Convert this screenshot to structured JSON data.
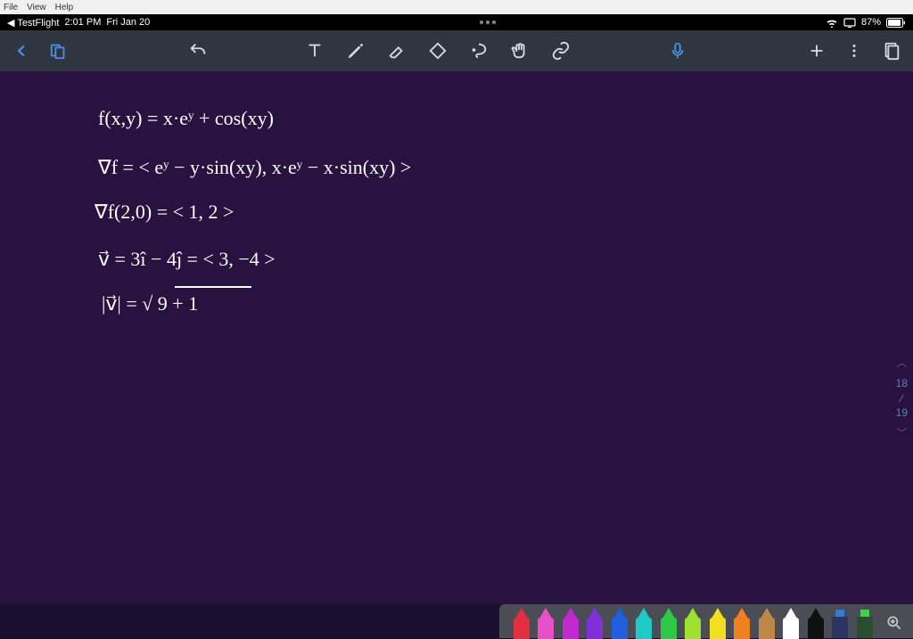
{
  "menu": {
    "file": "File",
    "view": "View",
    "help": "Help"
  },
  "status": {
    "back_app": "◀ TestFlight",
    "time": "2:01 PM",
    "date": "Fri Jan 20",
    "battery_pct": "87%"
  },
  "toolbar": {
    "back": "back",
    "browser": "browser",
    "undo": "undo",
    "text_tool": "text",
    "pen_tool": "pen",
    "eraser_tool": "eraser",
    "shape_eraser": "shape-eraser",
    "lasso": "lasso",
    "hand": "hand",
    "link": "link",
    "mic": "mic",
    "add": "add",
    "more": "more",
    "pages": "pages"
  },
  "notes": {
    "line1": "f(x,y) = x·eʸ + cos(xy)",
    "line2": "∇f = < eʸ − y·sin(xy),  x·eʸ − x·sin(xy) >",
    "line3": "∇f(2,0) = < 1, 2 >",
    "line4": "v⃗ = 3î − 4ĵ  =  < 3, −4 >",
    "line5": "|v⃗| = √ 9 + 1"
  },
  "pager": {
    "current": "18",
    "sep": "⁄",
    "total": "19"
  },
  "palette": {
    "pens": [
      {
        "name": "red",
        "color": "#e03040"
      },
      {
        "name": "pink",
        "color": "#e850c8"
      },
      {
        "name": "magenta",
        "color": "#c028d0"
      },
      {
        "name": "purple",
        "color": "#8030d8"
      },
      {
        "name": "blue",
        "color": "#2060e0"
      },
      {
        "name": "teal",
        "color": "#20c8c8"
      },
      {
        "name": "green",
        "color": "#30c848"
      },
      {
        "name": "lime",
        "color": "#a0e030"
      },
      {
        "name": "yellow",
        "color": "#f0e020"
      },
      {
        "name": "orange",
        "color": "#f08020"
      },
      {
        "name": "brown",
        "color": "#c08848"
      },
      {
        "name": "white",
        "color": "#ffffff"
      },
      {
        "name": "black",
        "color": "#101010"
      }
    ],
    "markers": [
      {
        "name": "marker-blue",
        "tip": "#3878d8",
        "body": "#2a3660"
      },
      {
        "name": "marker-green",
        "tip": "#40d050",
        "body": "#285030"
      }
    ]
  }
}
